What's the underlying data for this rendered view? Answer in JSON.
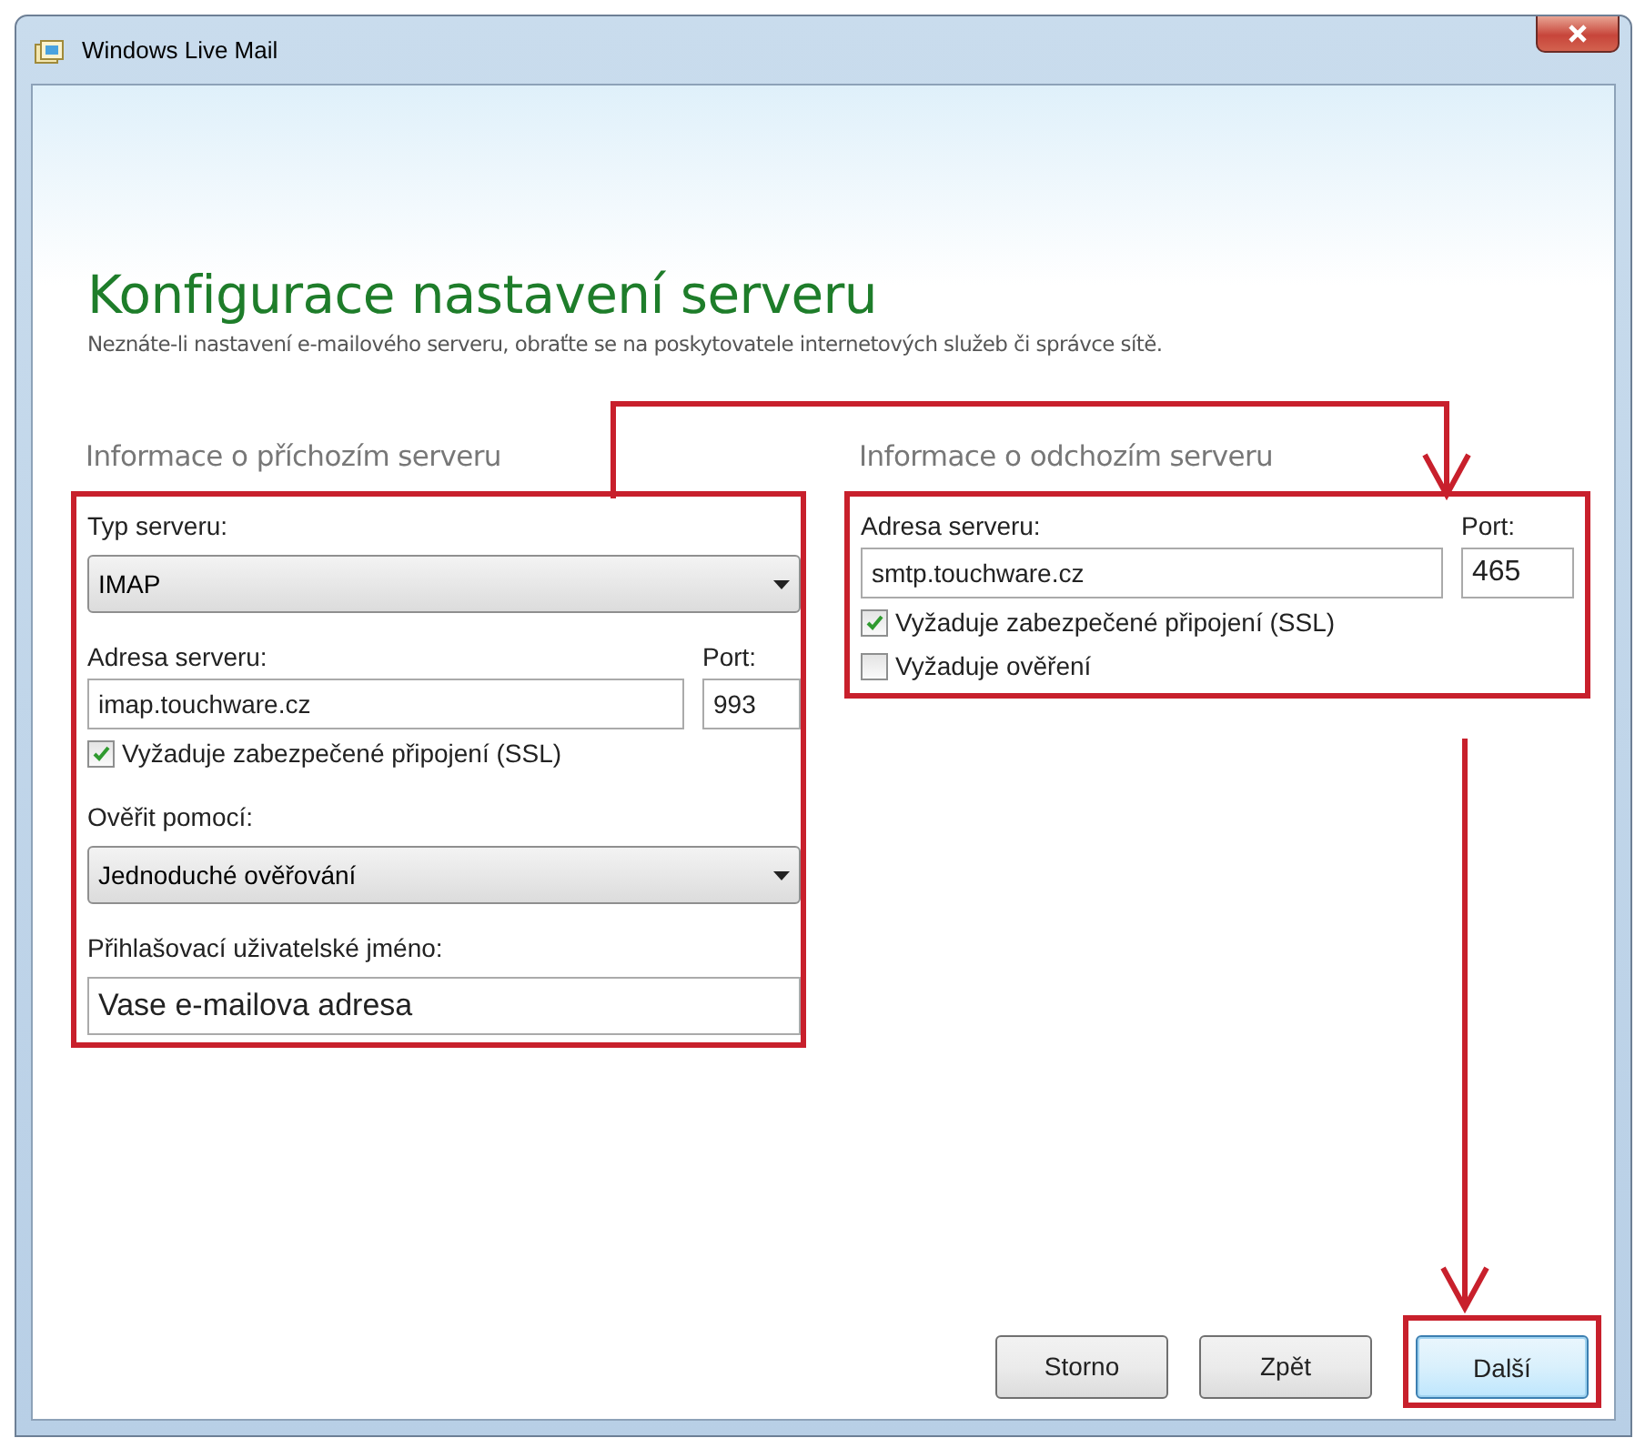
{
  "window": {
    "title": "Windows Live Mail"
  },
  "heading": "Konfigurace nastavení serveru",
  "subtitle": "Neznáte-li nastavení e-mailového serveru, obraťte se na poskytovatele internetových služeb či správce sítě.",
  "incoming": {
    "header": "Informace o příchozím serveru",
    "highlighted": true,
    "server_type": {
      "label": "Typ serveru:",
      "value": "IMAP"
    },
    "address": {
      "label": "Adresa serveru:",
      "value": "imap.touchware.cz"
    },
    "port": {
      "label": "Port:",
      "value": "993"
    },
    "checkboxes": [
      {
        "label": "Vyžaduje zabezpečené připojení (SSL)",
        "checked": true
      }
    ],
    "auth": {
      "label": "Ověřit pomocí:",
      "value": "Jednoduché ověřování"
    },
    "username": {
      "label": "Přihlašovací uživatelské jméno:",
      "value": "Vase e-mailova adresa"
    }
  },
  "outgoing": {
    "header": "Informace o odchozím serveru",
    "highlighted": true,
    "address": {
      "label": "Adresa serveru:",
      "value": "smtp.touchware.cz"
    },
    "port": {
      "label": "Port:",
      "value": "465"
    },
    "checkboxes": [
      {
        "label": "Vyžaduje zabezpečené připojení (SSL)",
        "checked": true
      },
      {
        "label": "Vyžaduje ověření",
        "checked": false
      }
    ]
  },
  "buttons": [
    {
      "label": "Storno",
      "kind": "normal",
      "highlighted": false
    },
    {
      "label": "Zpět",
      "kind": "normal",
      "highlighted": false
    },
    {
      "label": "Další",
      "kind": "default",
      "highlighted": true
    }
  ]
}
